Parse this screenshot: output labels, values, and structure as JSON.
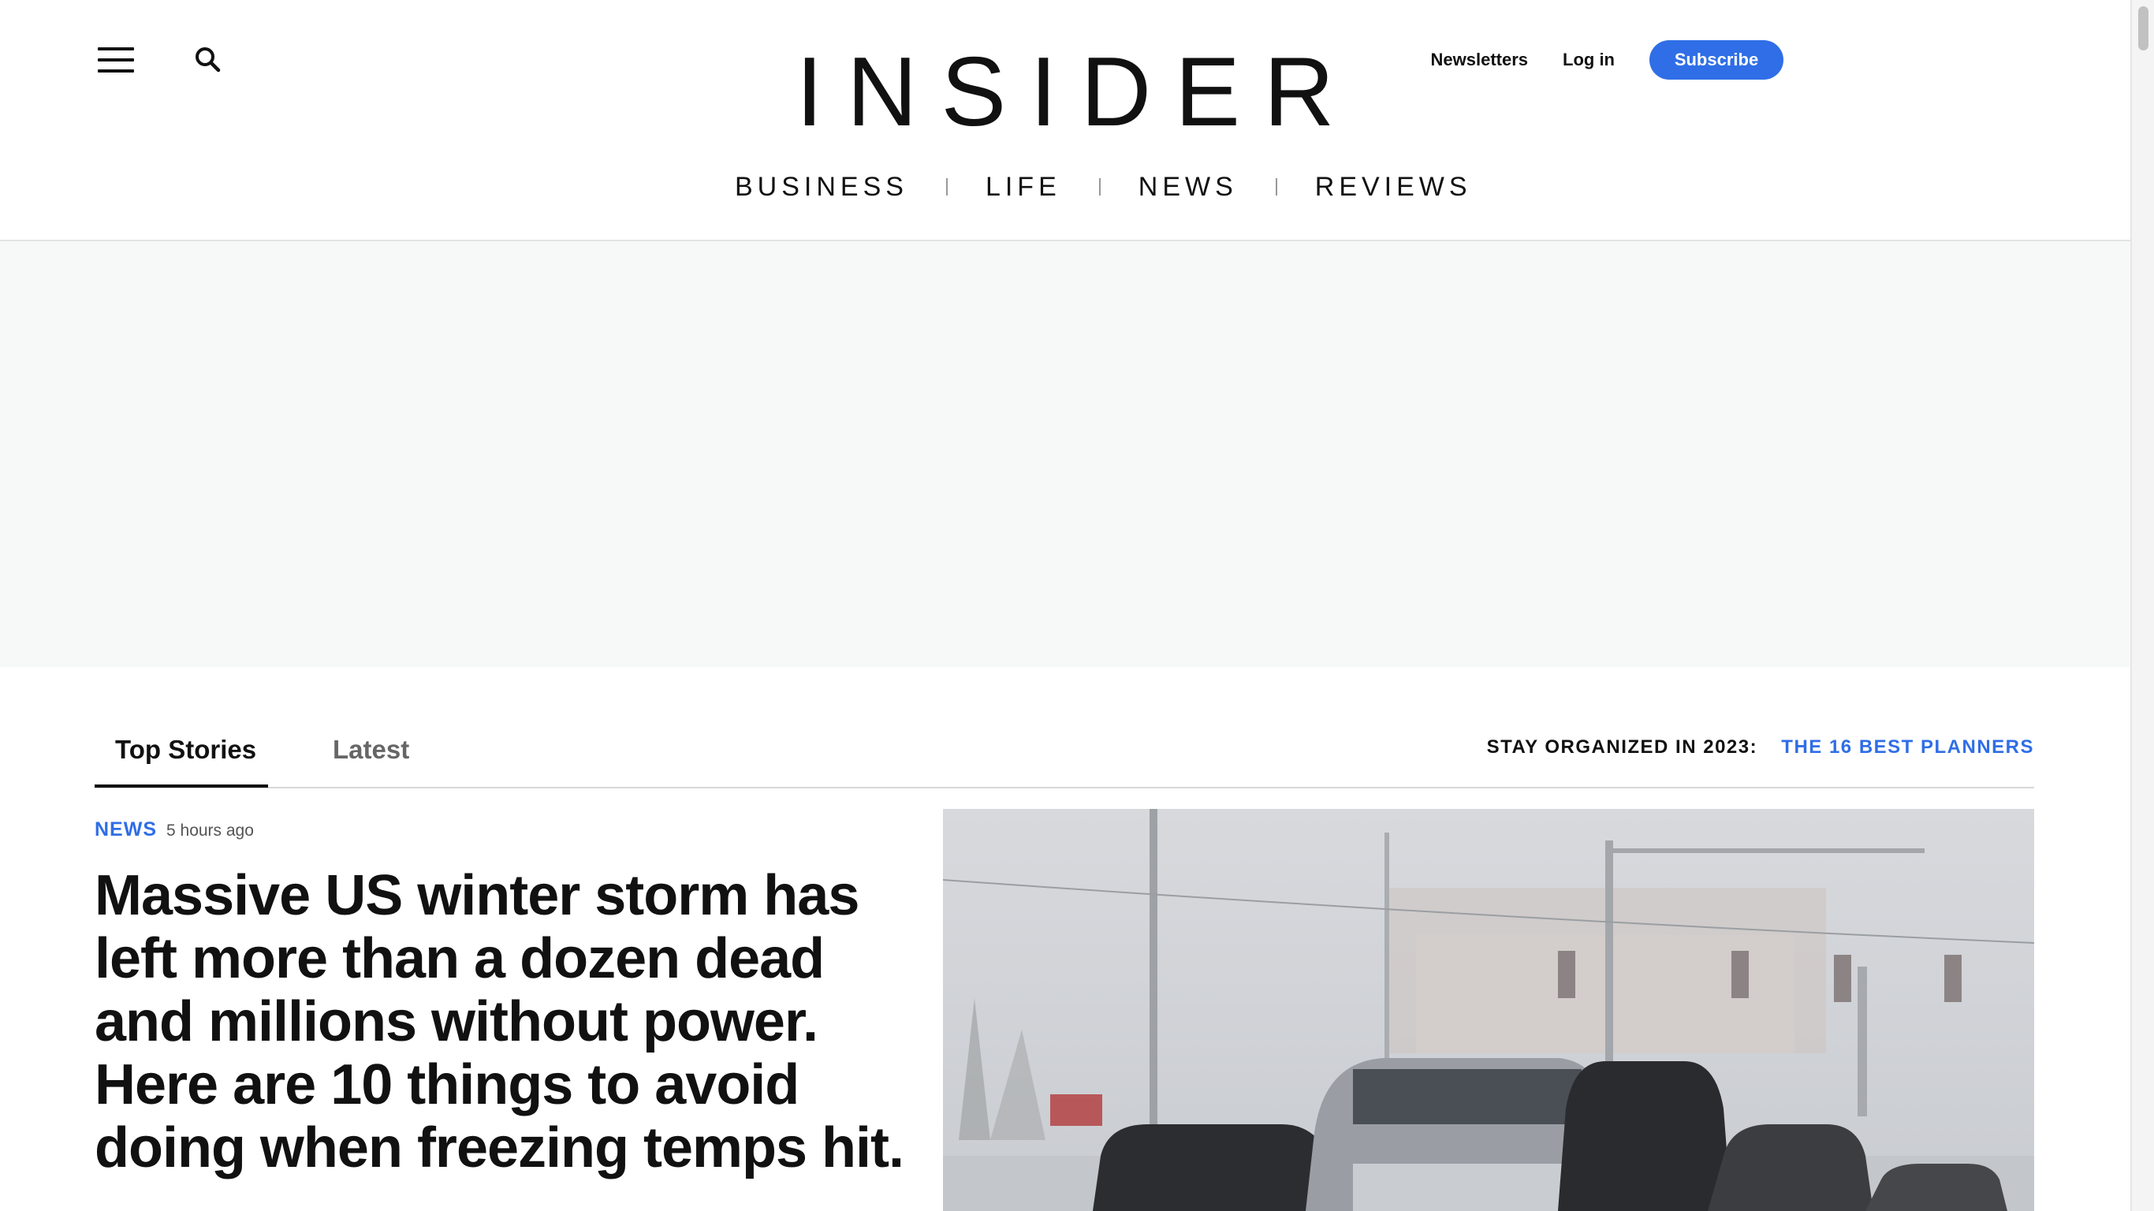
{
  "header": {
    "logo_text": "INSIDER",
    "newsletters": "Newsletters",
    "login": "Log in",
    "subscribe": "Subscribe",
    "nav": [
      "BUSINESS",
      "LIFE",
      "NEWS",
      "REVIEWS"
    ]
  },
  "tabs": {
    "top_stories": "Top Stories",
    "latest": "Latest"
  },
  "promo": {
    "prefix": "STAY ORGANIZED IN 2023:",
    "link": "THE 16 BEST PLANNERS"
  },
  "story": {
    "category": "NEWS",
    "time": "5 hours ago",
    "headline": "Massive US winter storm has left more than a dozen dead and millions without power. Here are 10 things to avoid doing when freezing temps hit."
  },
  "colors": {
    "accent": "#2f6ee6",
    "text": "#111111",
    "ad_background": "#f7f8f8"
  },
  "icons": [
    "menu-icon",
    "search-icon"
  ]
}
